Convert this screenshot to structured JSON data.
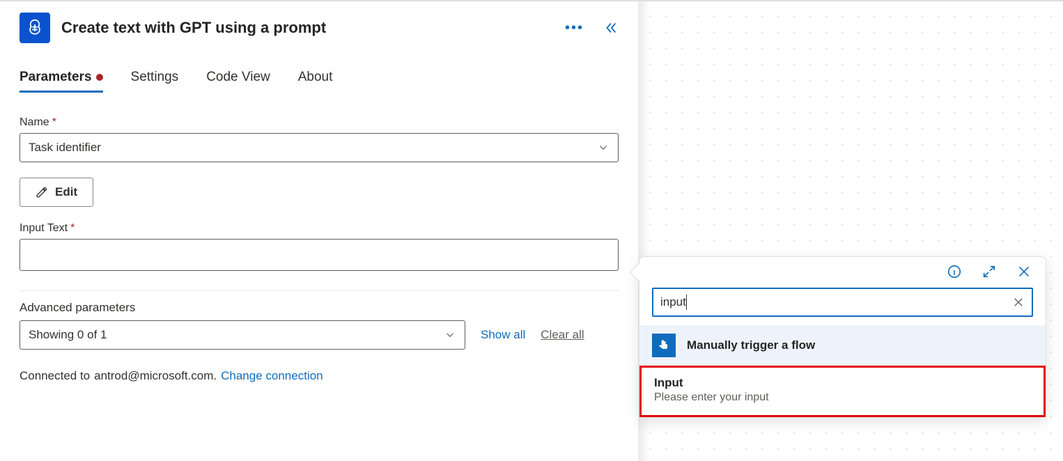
{
  "panel": {
    "title": "Create text with GPT using a prompt"
  },
  "tabs": [
    {
      "label": "Parameters",
      "active": true,
      "has_indicator": true
    },
    {
      "label": "Settings",
      "active": false,
      "has_indicator": false
    },
    {
      "label": "Code View",
      "active": false,
      "has_indicator": false
    },
    {
      "label": "About",
      "active": false,
      "has_indicator": false
    }
  ],
  "fields": {
    "name": {
      "label": "Name",
      "value": "Task identifier"
    },
    "edit_label": "Edit",
    "input_text": {
      "label": "Input Text",
      "value": ""
    }
  },
  "advanced": {
    "label": "Advanced parameters",
    "select_value": "Showing 0 of 1",
    "show_all": "Show all",
    "clear_all": "Clear all"
  },
  "connection": {
    "prefix": "Connected to",
    "email": "antrod@microsoft.com.",
    "change": "Change connection"
  },
  "popup": {
    "search_value": "input",
    "trigger_label": "Manually trigger a flow",
    "result_title": "Input",
    "result_sub": "Please enter your input"
  }
}
